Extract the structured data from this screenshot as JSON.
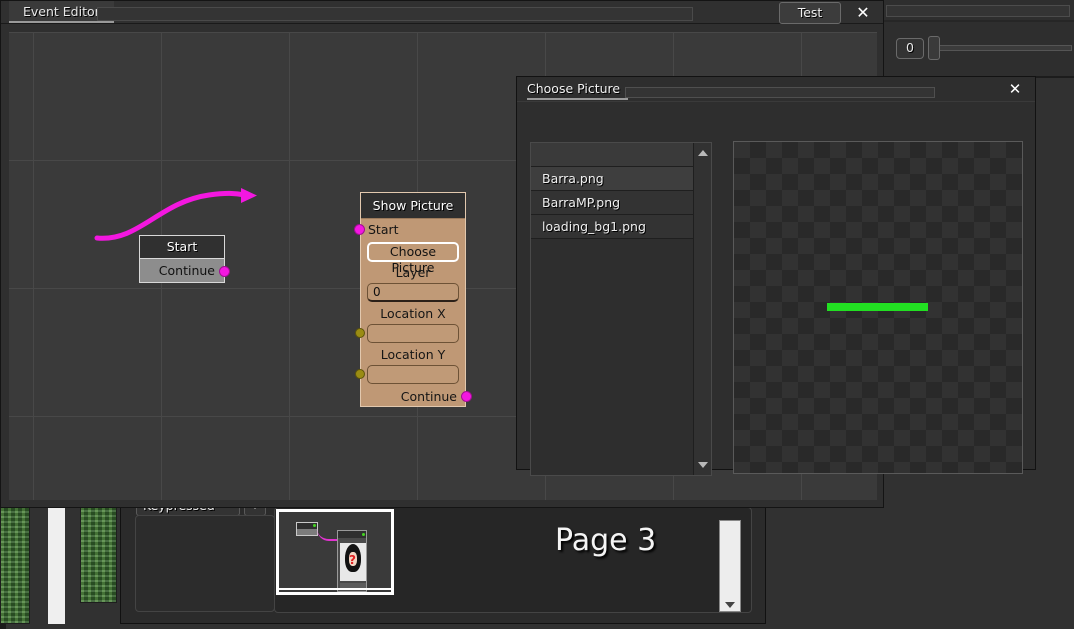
{
  "window": {
    "title": "Event Editor",
    "test_button": "Test",
    "close_icon": "✕"
  },
  "graph": {
    "nodes": [
      {
        "title": "Start",
        "rows": [
          "Continue"
        ]
      },
      {
        "title": "Show Picture",
        "input_label": "Start",
        "choose_picture_button": "Choose Picture",
        "fields": [
          {
            "label": "Layer",
            "value": "0"
          },
          {
            "label": "Location X",
            "value": ""
          },
          {
            "label": "Location Y",
            "value": ""
          }
        ],
        "output_label": "Continue"
      }
    ]
  },
  "dialog": {
    "title": "Choose Picture",
    "close_icon": "✕",
    "files": [
      {
        "name": "",
        "selected": false
      },
      {
        "name": "Barra.png",
        "selected": true
      },
      {
        "name": "BarraMP.png",
        "selected": false
      },
      {
        "name": "loading_bg1.png",
        "selected": false
      }
    ],
    "scroll_up_icon": "triangle-up-icon",
    "scroll_down_icon": "triangle-down-icon",
    "preview": {
      "alt": "Barra.png preview",
      "transparency_checkerboard": true,
      "bar_color": "#22e022"
    }
  },
  "bottom_panel": {
    "trigger_dropdown": "Keypressed",
    "dropdown_arrow_icon": "chevron-down-icon",
    "page_title": "Page 3",
    "scroll_down_icon": "chevron-down-icon"
  },
  "right_panel": {
    "value": "0"
  },
  "colors": {
    "node_accent": "#bf9875",
    "wire": "#f317e0",
    "exec_dot": "#44d621",
    "data_dot": "#9a8c13",
    "preview_bar": "#22e022"
  }
}
